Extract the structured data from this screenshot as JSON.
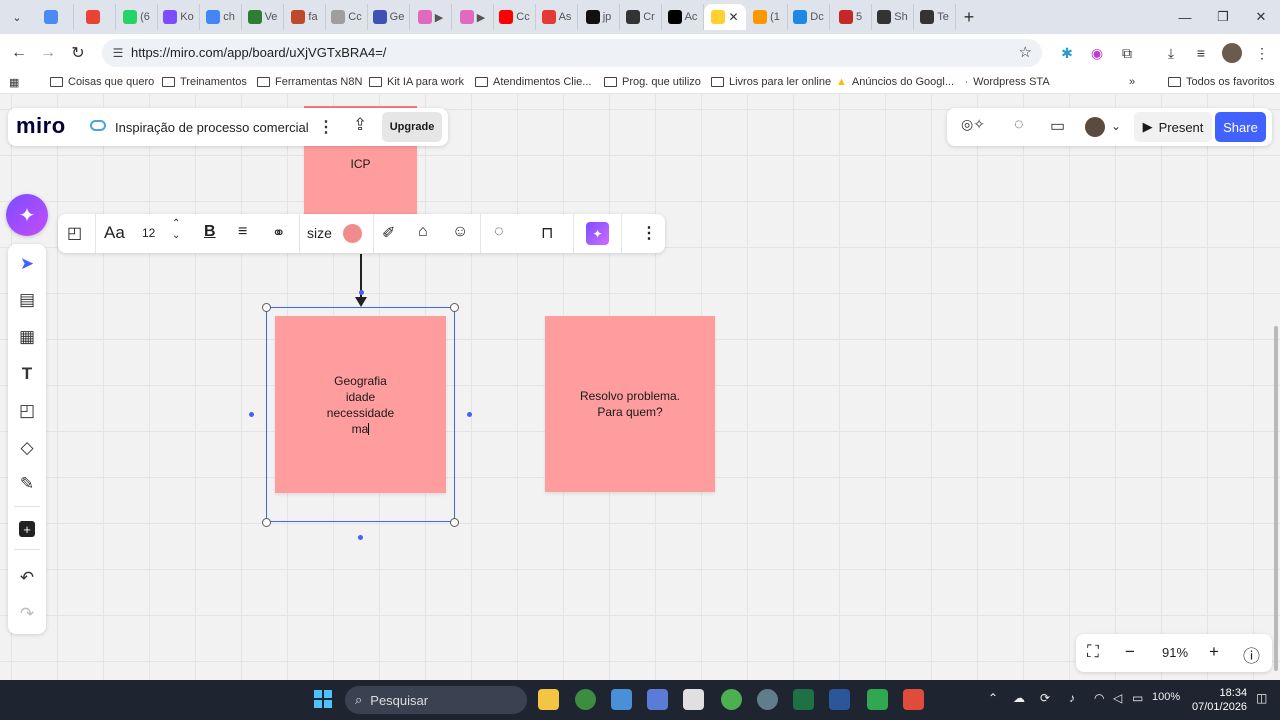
{
  "browser": {
    "tabs": [
      {
        "text": "",
        "color": "#4a8af4"
      },
      {
        "text": "",
        "color": "#ea4335"
      },
      {
        "text": "(6",
        "color": "#25d366"
      },
      {
        "text": "Ko",
        "color": "#7b4dff"
      },
      {
        "text": "ch",
        "color": "#4285f4"
      },
      {
        "text": "Ve",
        "color": "#2e7d32"
      },
      {
        "text": "fa",
        "color": "#bf4a2b"
      },
      {
        "text": "Cc",
        "color": "#9e9e9e"
      },
      {
        "text": "Ge",
        "color": "#3f51b5"
      },
      {
        "text": "▶",
        "color": "#e06ac0"
      },
      {
        "text": "▶",
        "color": "#e06ac0"
      },
      {
        "text": "Cc",
        "color": "#ff0000"
      },
      {
        "text": "As",
        "color": "#e53935"
      },
      {
        "text": "jp",
        "color": "#111111"
      },
      {
        "text": "Cr",
        "color": "#333333"
      },
      {
        "text": "Ac",
        "color": "#000000"
      },
      {
        "text": "(1",
        "color": "#ff9800"
      },
      {
        "text": "Dc",
        "color": "#1e88e5"
      },
      {
        "text": "5",
        "color": "#c62828"
      },
      {
        "text": "Sh",
        "color": "#333333"
      },
      {
        "text": "Te",
        "color": "#333333"
      }
    ],
    "active_tab": {
      "text": "",
      "color": "#ffd02f"
    },
    "url": "https://miro.com/app/board/uXjVGTxBRA4=/",
    "bookmarks": [
      "Coisas que quero",
      "Treinamentos",
      "Ferramentas N8N",
      "Kit IA para work",
      "Atendimentos Clie...",
      "Prog. que utilizo",
      "Livros para ler online",
      "Anúncios do Googl...",
      "Wordpress STA"
    ],
    "all_bookmarks": "Todos os favoritos"
  },
  "miro": {
    "logo": "miro",
    "board_title": "Inspiração de processo comercial",
    "upgrade": "Upgrade",
    "present": "Present",
    "share": "Share",
    "context_toolbar": {
      "font_size": "12",
      "size_label": "size",
      "color": "#f28b8b"
    },
    "sticky_notes": [
      {
        "lines": [
          "ICP"
        ]
      },
      {
        "lines": [
          "Geografia",
          "idade",
          "necessidade",
          "ma"
        ]
      },
      {
        "lines": [
          "Resolvo problema.",
          "Para quem?"
        ]
      }
    ],
    "sticky_color": "#ff9d9e",
    "zoom": "91%"
  },
  "taskbar": {
    "search_placeholder": "Pesquisar",
    "battery": "100%",
    "time": "18:34",
    "date": "07/01/2026"
  }
}
